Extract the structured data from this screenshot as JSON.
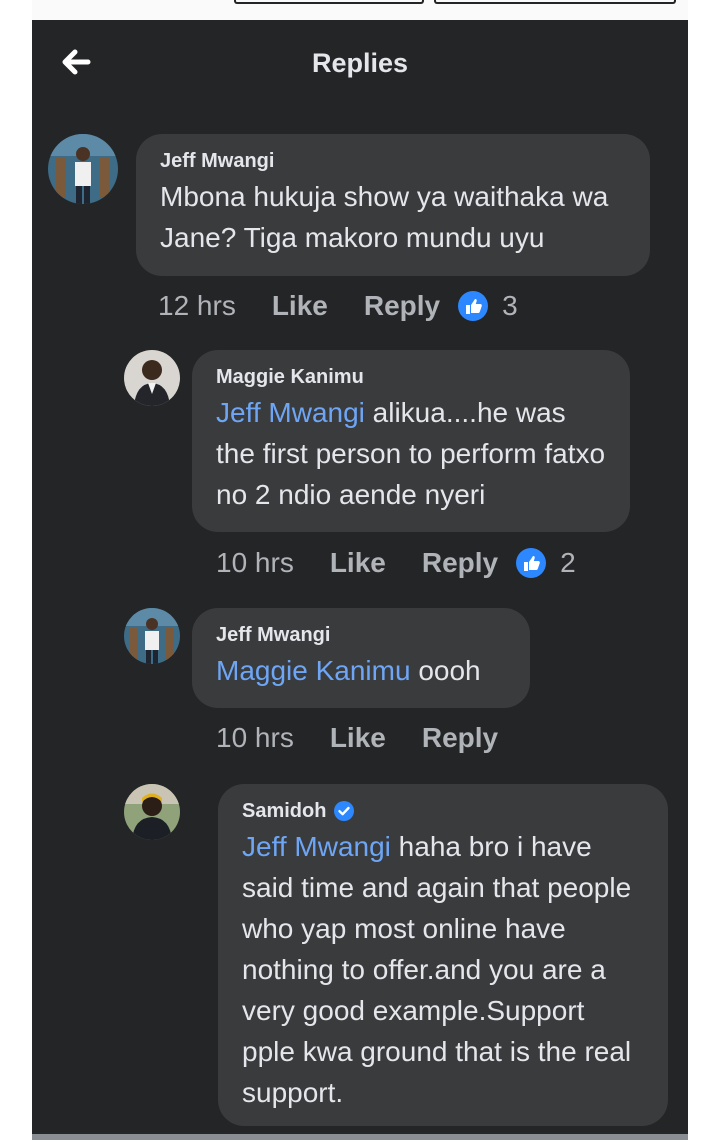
{
  "header": {
    "title": "Replies",
    "back_icon": "arrow-left-icon"
  },
  "colors": {
    "background": "#242526",
    "bubble": "#3a3b3c",
    "text": "#e4e6eb",
    "meta": "#b0b3b8",
    "mention": "#6ea6f5",
    "like": "#2d88ff"
  },
  "comments": [
    {
      "author": "Jeff Mwangi",
      "mention": "",
      "text": "Mbona hukuja show ya waithaka wa Jane? Tiga makoro mundu uyu",
      "time": "12 hrs",
      "like_label": "Like",
      "reply_label": "Reply",
      "reactions": "3"
    },
    {
      "author": "Maggie Kanimu",
      "mention": "Jeff Mwangi",
      "text": " alikua....he was the first person to perform fatxo no 2 ndio aende nyeri",
      "time": "10 hrs",
      "like_label": "Like",
      "reply_label": "Reply",
      "reactions": "2"
    },
    {
      "author": "Jeff Mwangi",
      "mention": "Maggie Kanimu",
      "text": " oooh",
      "time": "10 hrs",
      "like_label": "Like",
      "reply_label": "Reply",
      "reactions": ""
    },
    {
      "author": "Samidoh",
      "verified": true,
      "mention": "Jeff Mwangi",
      "text": " haha bro i have said time and again that people who yap most online have nothing to offer.and you are a very good example.Support pple kwa ground that is the real support."
    }
  ]
}
